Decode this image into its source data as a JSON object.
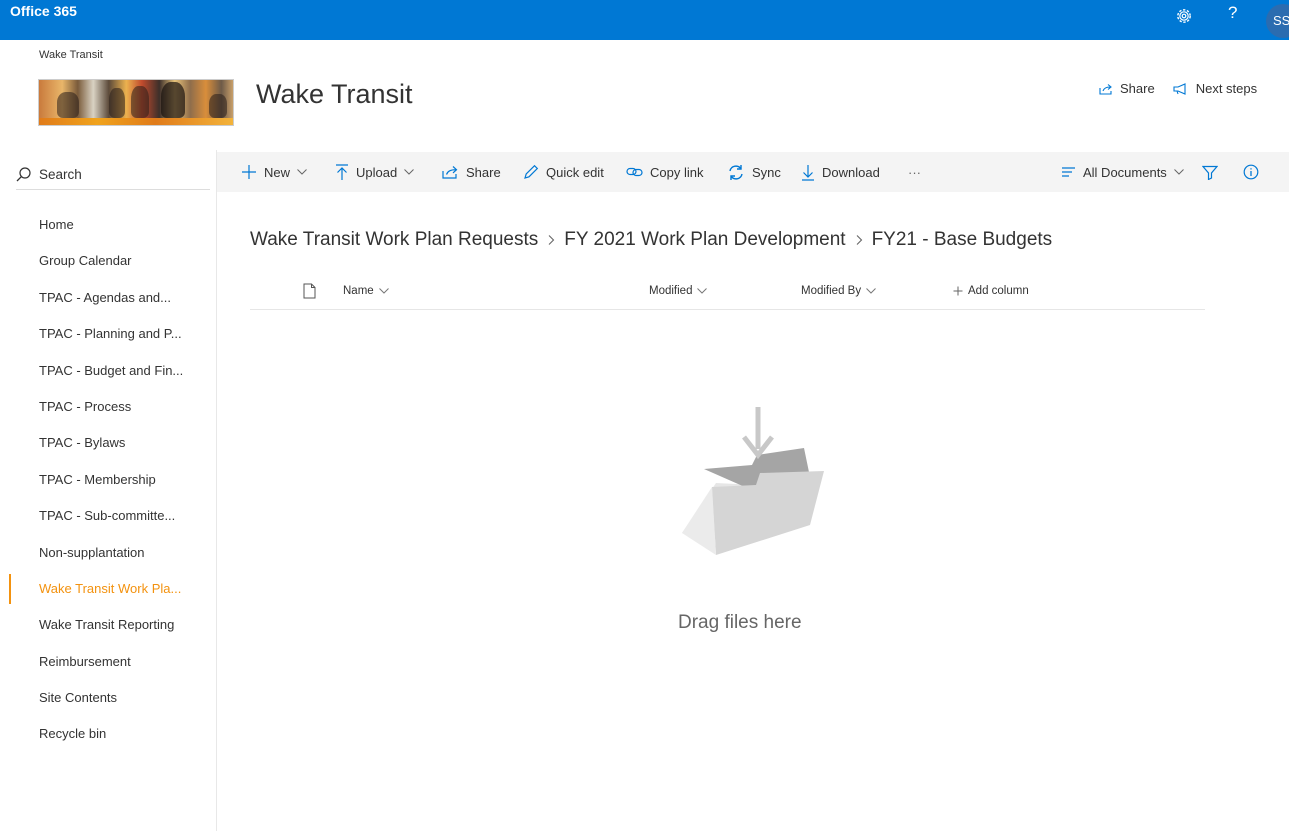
{
  "suite": {
    "brand": "Office 365",
    "avatar_initials": "SS"
  },
  "site": {
    "breadcrumb": "Wake Transit",
    "title": "Wake Transit",
    "actions": {
      "share": "Share",
      "next_steps": "Next steps"
    }
  },
  "nav": {
    "search_label": "Search",
    "items": [
      {
        "label": "Home"
      },
      {
        "label": "Group Calendar"
      },
      {
        "label": "TPAC - Agendas and..."
      },
      {
        "label": "TPAC - Planning and P..."
      },
      {
        "label": "TPAC - Budget and Fin..."
      },
      {
        "label": "TPAC - Process"
      },
      {
        "label": "TPAC - Bylaws"
      },
      {
        "label": "TPAC - Membership"
      },
      {
        "label": "TPAC - Sub-committe..."
      },
      {
        "label": "Non-supplantation"
      },
      {
        "label": "Wake Transit Work Pla..."
      },
      {
        "label": "Wake Transit Reporting"
      },
      {
        "label": "Reimbursement"
      },
      {
        "label": "Site Contents"
      },
      {
        "label": "Recycle bin"
      }
    ],
    "active_index": 10
  },
  "commands": {
    "new": "New",
    "upload": "Upload",
    "share": "Share",
    "quick_edit": "Quick edit",
    "copy_link": "Copy link",
    "sync": "Sync",
    "download": "Download",
    "more": "···",
    "view": "All Documents"
  },
  "breadcrumb": [
    "Wake Transit Work Plan Requests",
    "FY 2021 Work Plan Development",
    "FY21 - Base Budgets"
  ],
  "columns": {
    "name": "Name",
    "modified": "Modified",
    "modified_by": "Modified By",
    "add_column": "Add column"
  },
  "empty_state": {
    "message": "Drag files here"
  },
  "colors": {
    "suite_bar": "#0078d4",
    "accent": "#f3920f",
    "command_bar": "#f4f4f4"
  }
}
